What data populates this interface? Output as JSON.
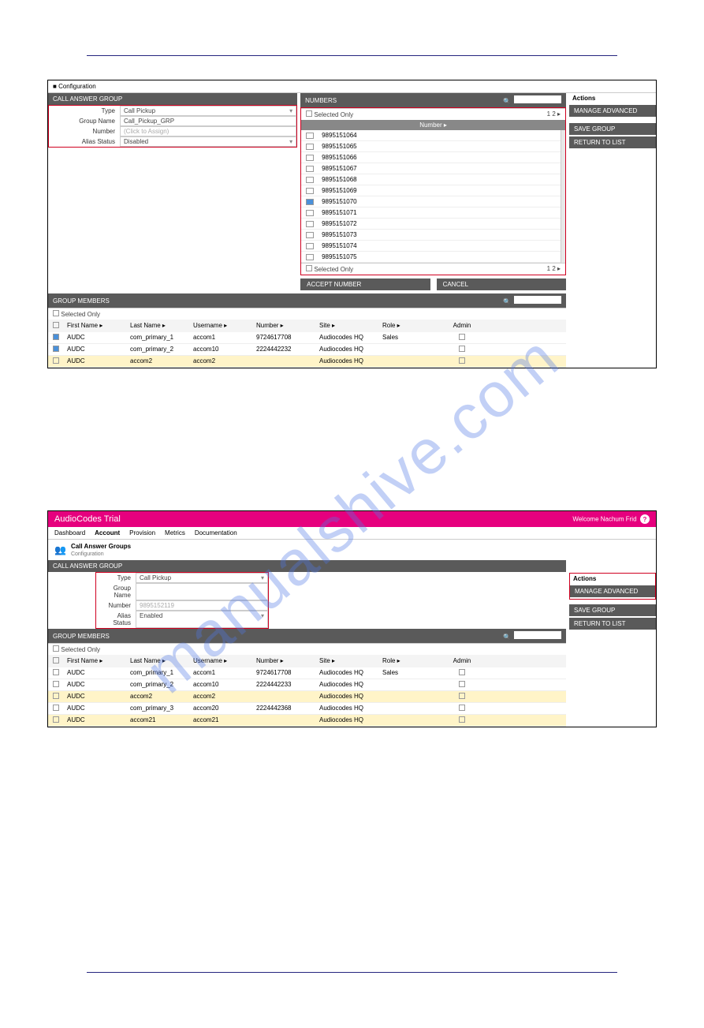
{
  "watermark": "manualshive.com",
  "shot1": {
    "tab": "Configuration",
    "panel_title": "CALL ANSWER GROUP",
    "form": {
      "type_lbl": "Type",
      "type_val": "Call Pickup",
      "gname_lbl": "Group Name",
      "gname_val": "Call_Pickup_GRP",
      "number_lbl": "Number",
      "number_ph": "(Click to Assign)",
      "alias_lbl": "Alias Status",
      "alias_val": "Disabled"
    },
    "numbers": {
      "title": "NUMBERS",
      "selected_only_top": "Selected Only",
      "page_top": "1  2  ▸",
      "col": "Number ▸",
      "rows": [
        {
          "v": "9895151064",
          "c": false
        },
        {
          "v": "9895151065",
          "c": false
        },
        {
          "v": "9895151066",
          "c": false
        },
        {
          "v": "9895151067",
          "c": false
        },
        {
          "v": "9895151068",
          "c": false
        },
        {
          "v": "9895151069",
          "c": false
        },
        {
          "v": "9895151070",
          "c": true
        },
        {
          "v": "9895151071",
          "c": false
        },
        {
          "v": "9895151072",
          "c": false
        },
        {
          "v": "9895151073",
          "c": false
        },
        {
          "v": "9895151074",
          "c": false
        },
        {
          "v": "9895151075",
          "c": false
        }
      ],
      "selected_only_bot": "Selected Only",
      "page_bot": "1  2  ▸"
    },
    "accept_btn": "ACCEPT NUMBER",
    "cancel_btn": "CANCEL",
    "actions": {
      "title": "Actions",
      "manage": "MANAGE ADVANCED",
      "save": "SAVE GROUP",
      "return": "RETURN TO LIST"
    },
    "members": {
      "title": "GROUP MEMBERS",
      "selected_only": "Selected Only",
      "cols": {
        "fn": "First Name ▸",
        "ln": "Last Name ▸",
        "un": "Username ▸",
        "nm": "Number ▸",
        "st": "Site ▸",
        "rl": "Role ▸",
        "ad": "Admin"
      },
      "rows": [
        {
          "c": true,
          "fn": "AUDC",
          "ln": "com_primary_1",
          "un": "accom1",
          "nm": "9724617708",
          "st": "Audiocodes HQ",
          "rl": "Sales"
        },
        {
          "c": true,
          "fn": "AUDC",
          "ln": "com_primary_2",
          "un": "accom10",
          "nm": "2224442232",
          "st": "Audiocodes HQ",
          "rl": ""
        },
        {
          "c": false,
          "fn": "AUDC",
          "ln": "accom2",
          "un": "accom2",
          "nm": "",
          "st": "Audiocodes HQ",
          "rl": "",
          "hl": true
        }
      ]
    }
  },
  "shot2": {
    "brand": "AudioCodes Trial",
    "welcome": "Welcome Nachum Frid",
    "nav": [
      "Dashboard",
      "Account",
      "Provision",
      "Metrics",
      "Documentation"
    ],
    "crumb_main": "Call Answer Groups",
    "crumb_sub": "Configuration",
    "panel_title": "CALL ANSWER GROUP",
    "form": {
      "type_lbl": "Type",
      "type_val": "Call Pickup",
      "gname_lbl": "Group Name",
      "gname_val": "",
      "number_lbl": "Number",
      "number_val": "9895152119",
      "alias_lbl": "Alias Status",
      "alias_val": "Enabled"
    },
    "actions": {
      "title": "Actions",
      "manage": "MANAGE ADVANCED",
      "save": "SAVE GROUP",
      "return": "RETURN TO LIST"
    },
    "members": {
      "title": "GROUP MEMBERS",
      "selected_only": "Selected Only",
      "cols": {
        "fn": "First Name ▸",
        "ln": "Last Name ▸",
        "un": "Username ▸",
        "nm": "Number ▸",
        "st": "Site ▸",
        "rl": "Role ▸",
        "ad": "Admin"
      },
      "rows": [
        {
          "c": false,
          "fn": "AUDC",
          "ln": "com_primary_1",
          "un": "accom1",
          "nm": "9724617708",
          "st": "Audiocodes HQ",
          "rl": "Sales"
        },
        {
          "c": false,
          "fn": "AUDC",
          "ln": "com_primary_2",
          "un": "accom10",
          "nm": "2224442233",
          "st": "Audiocodes HQ",
          "rl": ""
        },
        {
          "c": false,
          "fn": "AUDC",
          "ln": "accom2",
          "un": "accom2",
          "nm": "",
          "st": "Audiocodes HQ",
          "rl": "",
          "hl": true
        },
        {
          "c": false,
          "fn": "AUDC",
          "ln": "com_primary_3",
          "un": "accom20",
          "nm": "2224442368",
          "st": "Audiocodes HQ",
          "rl": ""
        },
        {
          "c": false,
          "fn": "AUDC",
          "ln": "accom21",
          "un": "accom21",
          "nm": "",
          "st": "Audiocodes HQ",
          "rl": "",
          "hl": true
        }
      ]
    }
  }
}
